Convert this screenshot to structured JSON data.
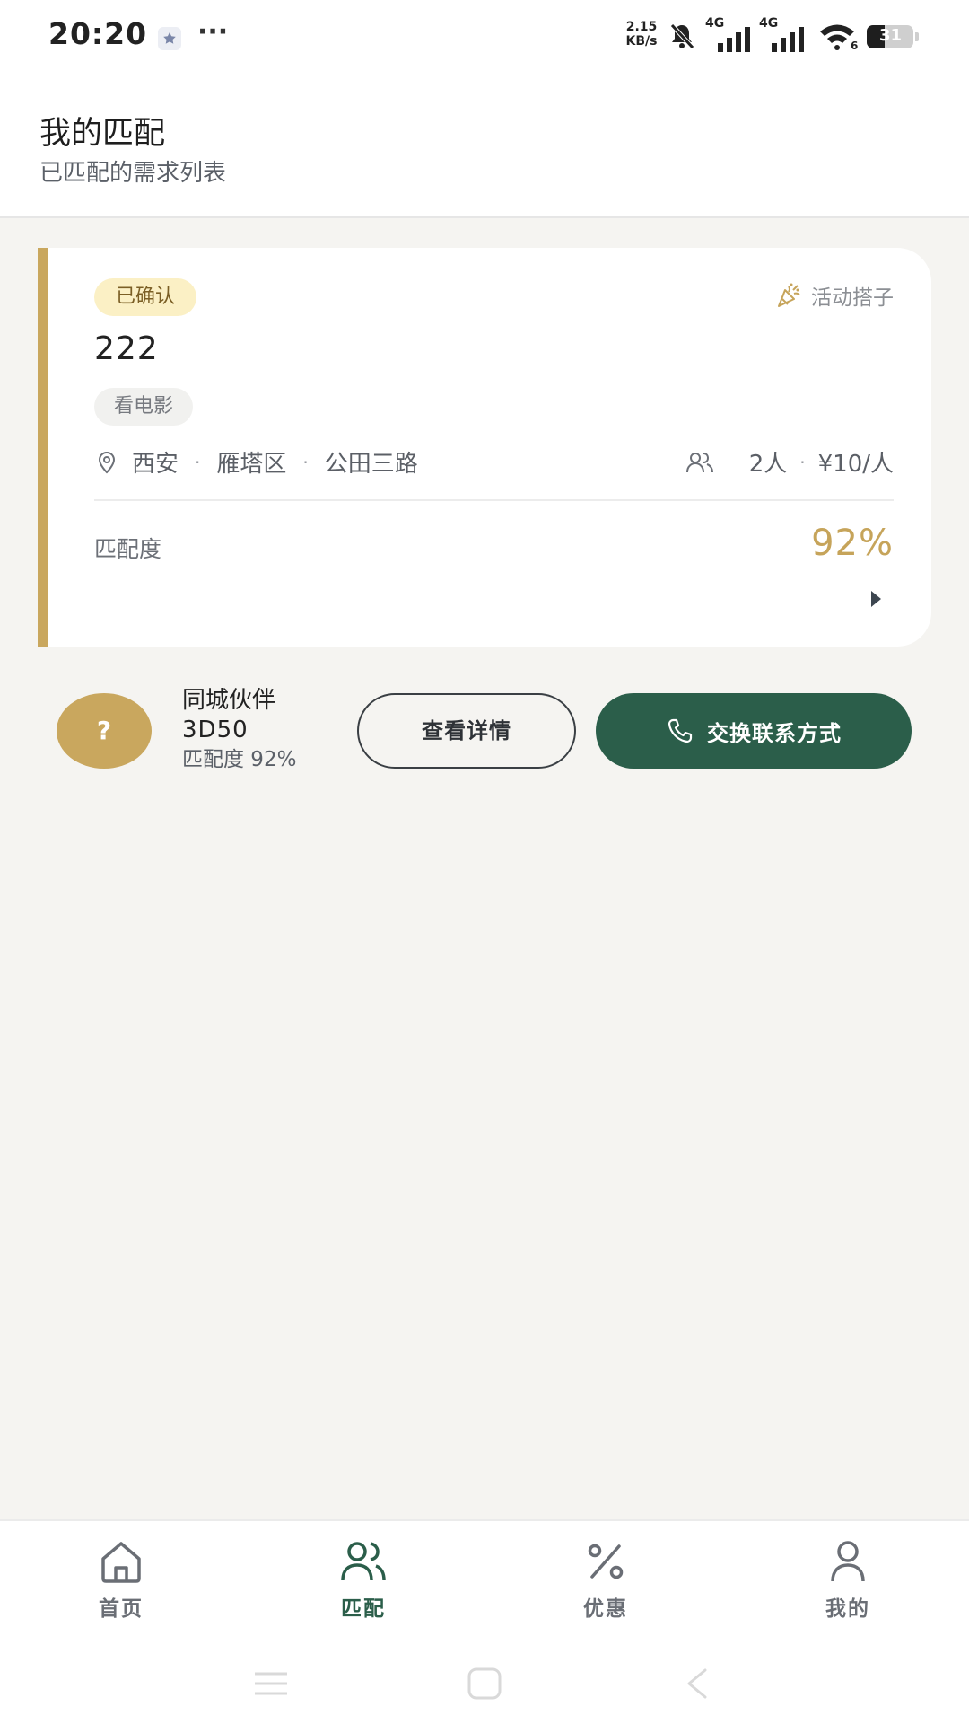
{
  "status_bar": {
    "time": "20:20",
    "more": "···",
    "net_speed_value": "2.15",
    "net_speed_unit": "KB/s",
    "signal_1_label": "4G",
    "signal_2_label": "4G",
    "wifi_label": "6",
    "battery": "31"
  },
  "header": {
    "title": "我的匹配",
    "subtitle": "已匹配的需求列表"
  },
  "card": {
    "status_badge": "已确认",
    "category": "活动搭子",
    "title": "222",
    "activity": "看电影",
    "location": {
      "city": "西安",
      "district": "雁塔区",
      "road": "公田三路"
    },
    "people": "2人",
    "price": "¥10/人",
    "match_label": "匹配度",
    "match_value": "92%",
    "match_score": 0.92
  },
  "partner": {
    "avatar_text": "?",
    "name": "同城伙伴",
    "code": "3D50",
    "match_text": "匹配度 92%"
  },
  "actions": {
    "details_label": "查看详情",
    "exchange_label": "交换联系方式"
  },
  "nav": {
    "items": [
      {
        "label": "首页",
        "icon": "home-icon",
        "active": false
      },
      {
        "label": "匹配",
        "icon": "users-icon",
        "active": true
      },
      {
        "label": "优惠",
        "icon": "percent-icon",
        "active": false
      },
      {
        "label": "我的",
        "icon": "user-icon",
        "active": false
      }
    ]
  },
  "colors": {
    "accent_gold": "#c9a75e",
    "primary_green": "#2b5e4a",
    "badge_bg": "#fbf0c5",
    "page_bg": "#f5f4f1"
  }
}
